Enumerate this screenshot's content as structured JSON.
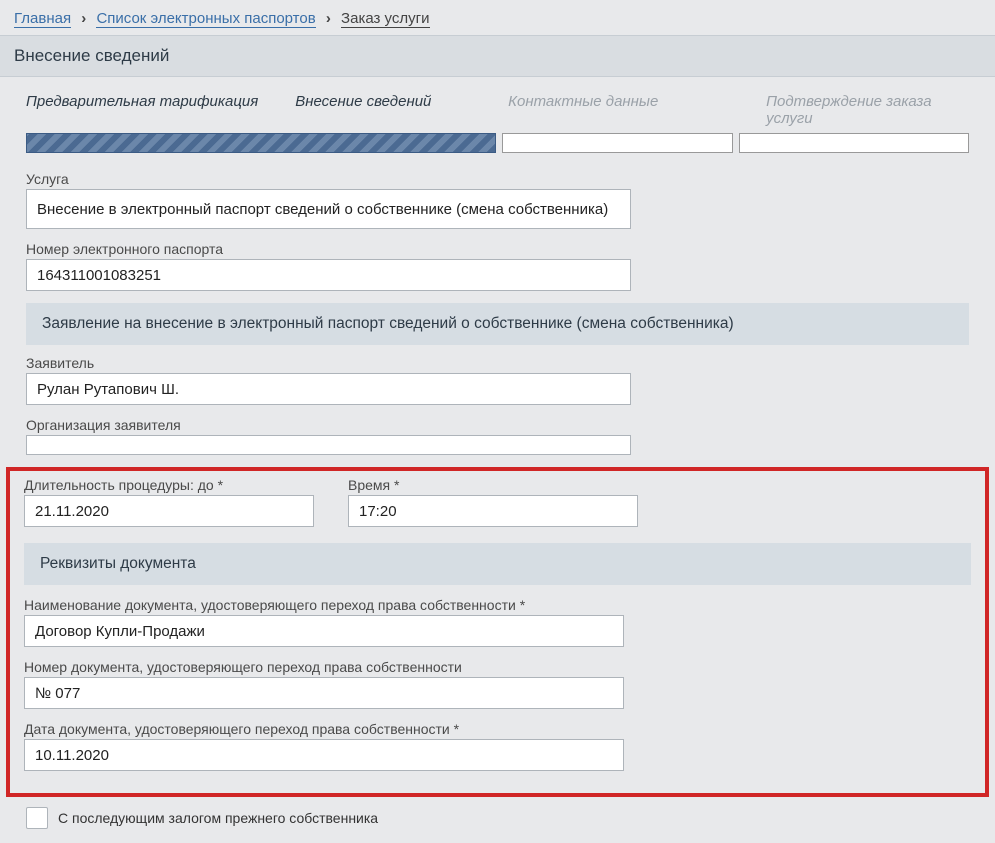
{
  "breadcrumb": {
    "home": "Главная",
    "list": "Список электронных паспортов",
    "current": "Заказ услуги"
  },
  "header": "Внесение сведений",
  "steps": {
    "s1": "Предварительная тарификация",
    "s2": "Внесение сведений",
    "s3": "Контактные данные",
    "s4": "Подтверждение заказа услуги"
  },
  "service": {
    "label": "Услуга",
    "value": "Внесение в электронный паспорт сведений о собственнике (смена собственника)"
  },
  "passport": {
    "label": "Номер электронного паспорта",
    "value": "164311001083251"
  },
  "sectionApp": "Заявление на внесение в электронный паспорт сведений о собственнике (смена собственника)",
  "applicant": {
    "label": "Заявитель",
    "value": "Рулан Рутапович Ш."
  },
  "org": {
    "label": "Организация заявителя",
    "value": ""
  },
  "duration": {
    "label": "Длительность процедуры: до *",
    "value": "21.11.2020"
  },
  "time": {
    "label": "Время *",
    "value": "17:20"
  },
  "sectionDoc": "Реквизиты документа",
  "docName": {
    "label": "Наименование документа, удостоверяющего переход права собственности *",
    "value": "Договор Купли-Продажи"
  },
  "docNum": {
    "label": "Номер документа, удостоверяющего переход права собственности",
    "value": "№ 077"
  },
  "docDate": {
    "label": "Дата документа, удостоверяющего переход права собственности *",
    "value": "10.11.2020"
  },
  "pledge": "С последующим залогом прежнего собственника"
}
